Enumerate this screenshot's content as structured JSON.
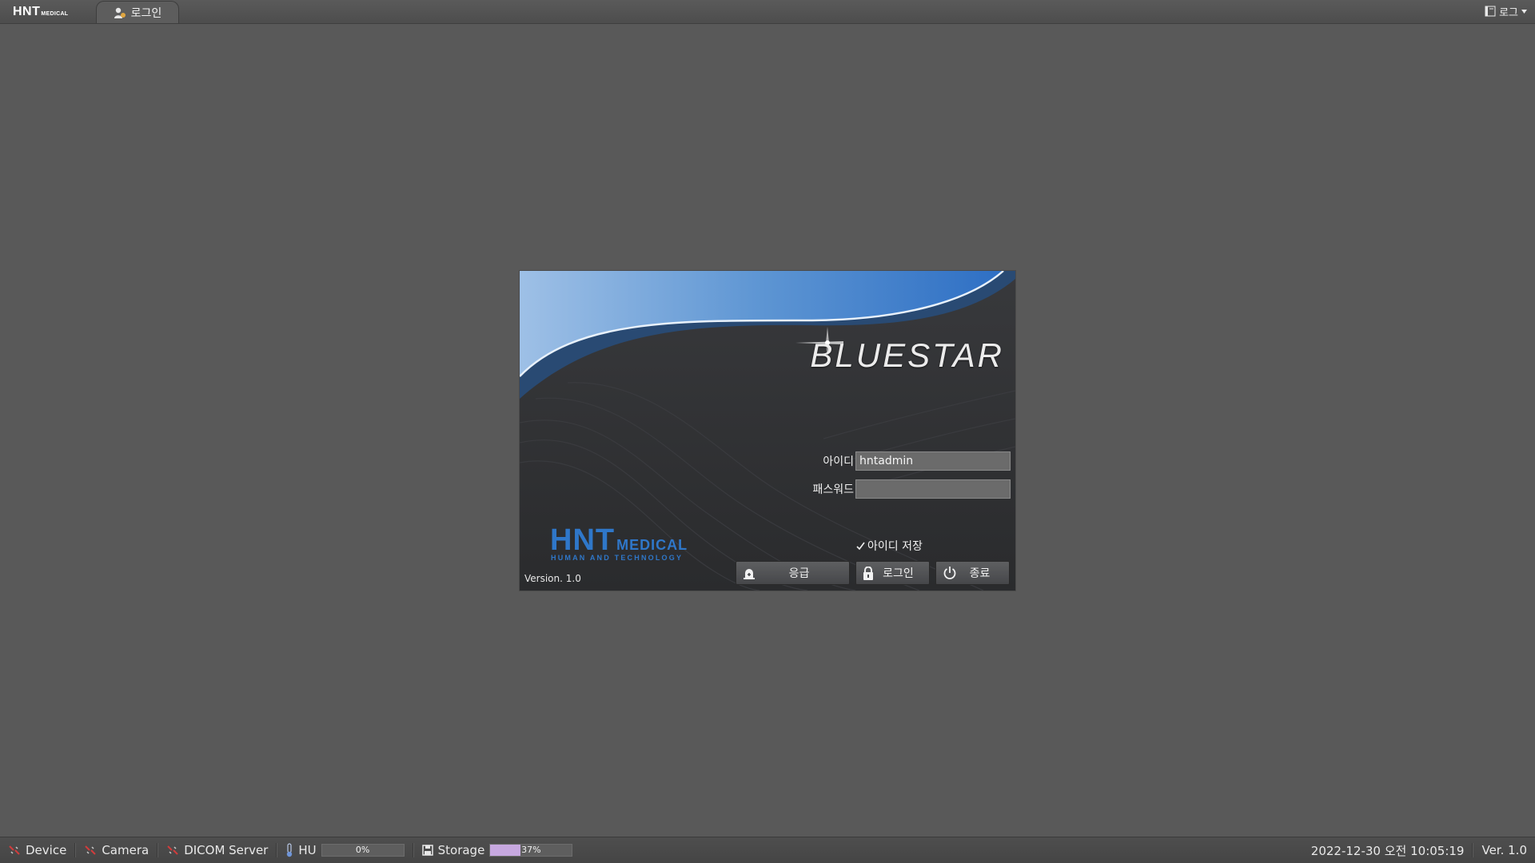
{
  "topbar": {
    "logo_main": "HNT",
    "logo_sub": "MEDICAL",
    "tab_label": "로그인",
    "log_menu_label": "로그"
  },
  "login": {
    "brand": "BLUESTAR",
    "id_label": "아이디",
    "id_value": "hntadmin",
    "password_label": "패스워드",
    "password_value": "",
    "save_id_label": "아이디 저장",
    "save_id_checked": true,
    "logo_big": "HNT",
    "logo_med": "MEDICAL",
    "logo_tagline": "HUMAN AND TECHNOLOGY",
    "version": "Version. 1.0",
    "buttons": {
      "emergency": "응급",
      "login": "로그인",
      "exit": "종료"
    }
  },
  "statusbar": {
    "device": "Device",
    "camera": "Camera",
    "dicom": "DICOM Server",
    "hu_label": "HU",
    "hu_percent": 0,
    "hu_text": "0%",
    "storage_label": "Storage",
    "storage_percent": 37,
    "storage_text": "37%",
    "datetime": "2022-12-30 오전 10:05:19",
    "version": "Ver. 1.0"
  },
  "colors": {
    "background": "#595959",
    "accent_blue": "#2f77c9",
    "storage_fill": "#c7a8e0",
    "status_error": "#d23c3c"
  }
}
